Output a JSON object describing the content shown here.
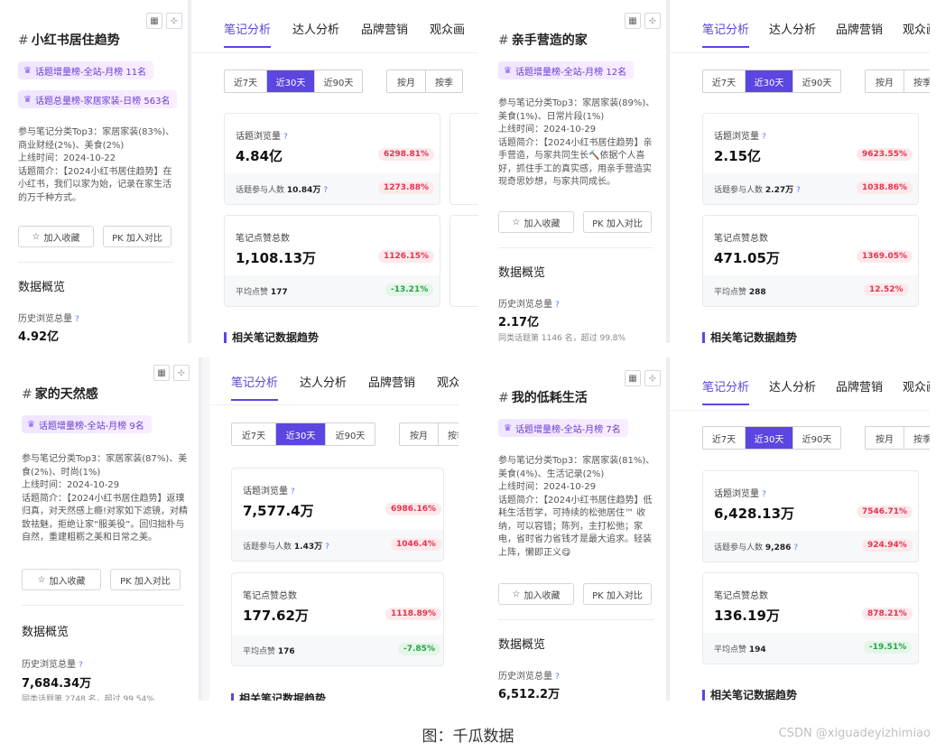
{
  "common": {
    "tabs": [
      "笔记分析",
      "达人分析",
      "品牌营销",
      "观众画"
    ],
    "ranges": [
      "近7天",
      "近30天",
      "近90天"
    ],
    "ranges2": [
      "按月",
      "按季"
    ],
    "add_fav": "加入收藏",
    "add_compare": "PK 加入对比",
    "data_overview": "数据概览",
    "history_views": "历史浏览总量",
    "topic_views": "话题浏览量",
    "topic_participants": "话题参与人数",
    "note_likes": "笔记点赞总数",
    "avg_likes": "平均点赞",
    "related_trend": "相关笔记数据趋势"
  },
  "panels": [
    {
      "title": "小红书居住趋势",
      "badges": [
        "话题增量榜-全站-月榜 11名",
        "话题总量榜-家居家装-日榜 563名"
      ],
      "info": [
        "参与笔记分类Top3：家居家装(83%)、商业财经(2%)、美食(2%)",
        "上线时间：2024-10-22",
        "话题简介：【2024小红书居住趋势】在小红书，我们以家为始，记录在家生活的万千种方式。"
      ],
      "history_value": "4.92亿",
      "views": "4.84亿",
      "views_pct": "6298.81%",
      "participants": "10.84万",
      "participants_pct": "1273.88%",
      "likes": "1,108.13万",
      "likes_pct": "1126.15%",
      "avg": "177",
      "avg_pct": "-13.21%",
      "avg_trend": "down"
    },
    {
      "title": "亲手营造的家",
      "badges": [
        "话题增量榜-全站-月榜 12名"
      ],
      "info": [
        "参与笔记分类Top3：家居家装(89%)、美食(1%)、日常片段(1%)",
        "上线时间：2024-10-29",
        "话题简介：【2024小红书居住趋势】亲手营造，与家共同生长🔨依据个人喜好，抓住手工的真实感，用亲手营造实现奇思妙想，与家共同成长。"
      ],
      "history_value": "2.17亿",
      "history_note": "同类话题第 1146 名，超过 99.8%",
      "views": "2.15亿",
      "views_pct": "9623.55%",
      "participants": "2.27万",
      "participants_pct": "1038.86%",
      "likes": "471.05万",
      "likes_pct": "1369.05%",
      "avg": "288",
      "avg_pct": "12.52%",
      "avg_trend": "up"
    },
    {
      "title": "家的天然感",
      "badges": [
        "话题增量榜-全站-月榜 9名"
      ],
      "info": [
        "参与笔记分类Top3：家居家装(87%)、美食(2%)、时尚(1%)",
        "上线时间：2024-10-29",
        "话题简介：【2024小红书居住趋势】返璞归真，对天然感上瘾!对家如下滤镜，对精致祛魅，拒绝让家“服美役”。回归拙朴与自然，重建粗粝之美和日常之美。"
      ],
      "history_value": "7,684.34万",
      "history_note": "同类话题第 2748 名，超过 99.54%",
      "views": "7,577.4万",
      "views_pct": "6986.16%",
      "participants": "1.43万",
      "participants_pct": "1046.4%",
      "likes": "177.62万",
      "likes_pct": "1118.89%",
      "avg": "176",
      "avg_pct": "-7.85%",
      "avg_trend": "down"
    },
    {
      "title": "我的低耗生活",
      "badges": [
        "话题增量榜-全站-月榜 7名"
      ],
      "info": [
        "参与笔记分类Top3：家居家装(81%)、美食(4%)、生活记录(2%)",
        "上线时间：2024-10-29",
        "话题简介：【2024小红书居住趋势】低耗生活哲学，可持续的松弛居住™ 收纳，可以容错；陈列，主打松弛；家电，省时省力省钱才是最大追求。轻装上阵，懒即正义😋"
      ],
      "history_value": "6,512.2万",
      "views": "6,428.13万",
      "views_pct": "7546.71%",
      "participants": "9,286",
      "participants_pct": "924.94%",
      "likes": "136.19万",
      "likes_pct": "878.21%",
      "avg": "194",
      "avg_pct": "-19.51%",
      "avg_trend": "down"
    }
  ],
  "caption": "图：千瓜数据",
  "watermark": "CSDN @xiguadeyizhimiao",
  "colors": {
    "accent": "#5b46e0",
    "up": "#e5344e",
    "down": "#27a348"
  }
}
